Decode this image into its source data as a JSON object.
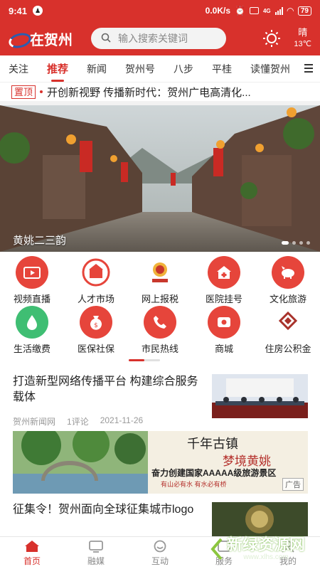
{
  "status_bar": {
    "time": "9:41",
    "network_speed": "0.0K/s",
    "network_type": "4G",
    "battery": "79"
  },
  "header": {
    "logo_text": "在贺州",
    "search_placeholder": "输入搜索关键词",
    "weather": {
      "condition": "晴",
      "temperature": "13℃"
    }
  },
  "tabs": [
    {
      "label": "关注"
    },
    {
      "label": "推荐",
      "active": true
    },
    {
      "label": "新闻"
    },
    {
      "label": "贺州号"
    },
    {
      "label": "八步"
    },
    {
      "label": "平桂"
    },
    {
      "label": "读懂贺州"
    }
  ],
  "pinned": {
    "badge": "置顶",
    "headline": "开创新视野 传播新时代：贺州广电高清化..."
  },
  "banner": {
    "caption": "黄姚二三韵",
    "slide_count": 4,
    "active_slide": 1
  },
  "services": [
    {
      "label": "视频直播",
      "icon": "tv-icon"
    },
    {
      "label": "人才市场",
      "icon": "talent-market-logo"
    },
    {
      "label": "网上报税",
      "icon": "tax-emblem-icon"
    },
    {
      "label": "医院挂号",
      "icon": "hospital-icon"
    },
    {
      "label": "文化旅游",
      "icon": "pig-icon"
    },
    {
      "label": "生活缴费",
      "icon": "water-drop-icon"
    },
    {
      "label": "医保社保",
      "icon": "money-bag-icon"
    },
    {
      "label": "市民热线",
      "icon": "phone-icon"
    },
    {
      "label": "商城",
      "icon": "shop-icon"
    },
    {
      "label": "住房公积金",
      "icon": "housing-fund-logo"
    }
  ],
  "feed": {
    "news1": {
      "title": "打造新型网络传播平台 构建综合服务载体",
      "source": "贺州新闻网",
      "comments": "1评论",
      "date": "2021-11-26"
    },
    "ad": {
      "title": "千年古镇",
      "subtitle": "梦境黄姚",
      "slogan": "奋力创建国家AAAAA级旅游景区",
      "small_text": "有山必有水 有水必有桥",
      "tag": "广告"
    },
    "news2": {
      "title": "征集令！贺州面向全球征集城市logo"
    }
  },
  "bottom_nav": [
    {
      "label": "首页",
      "active": true
    },
    {
      "label": "融媒"
    },
    {
      "label": "互动"
    },
    {
      "label": "服务"
    },
    {
      "label": "我的"
    }
  ],
  "watermark": {
    "text": "新绿资源网",
    "url": "www.xlhs.com"
  },
  "colors": {
    "brand_red": "#d8312c",
    "icon_red": "#e6453b",
    "green": "#3fbe73"
  }
}
